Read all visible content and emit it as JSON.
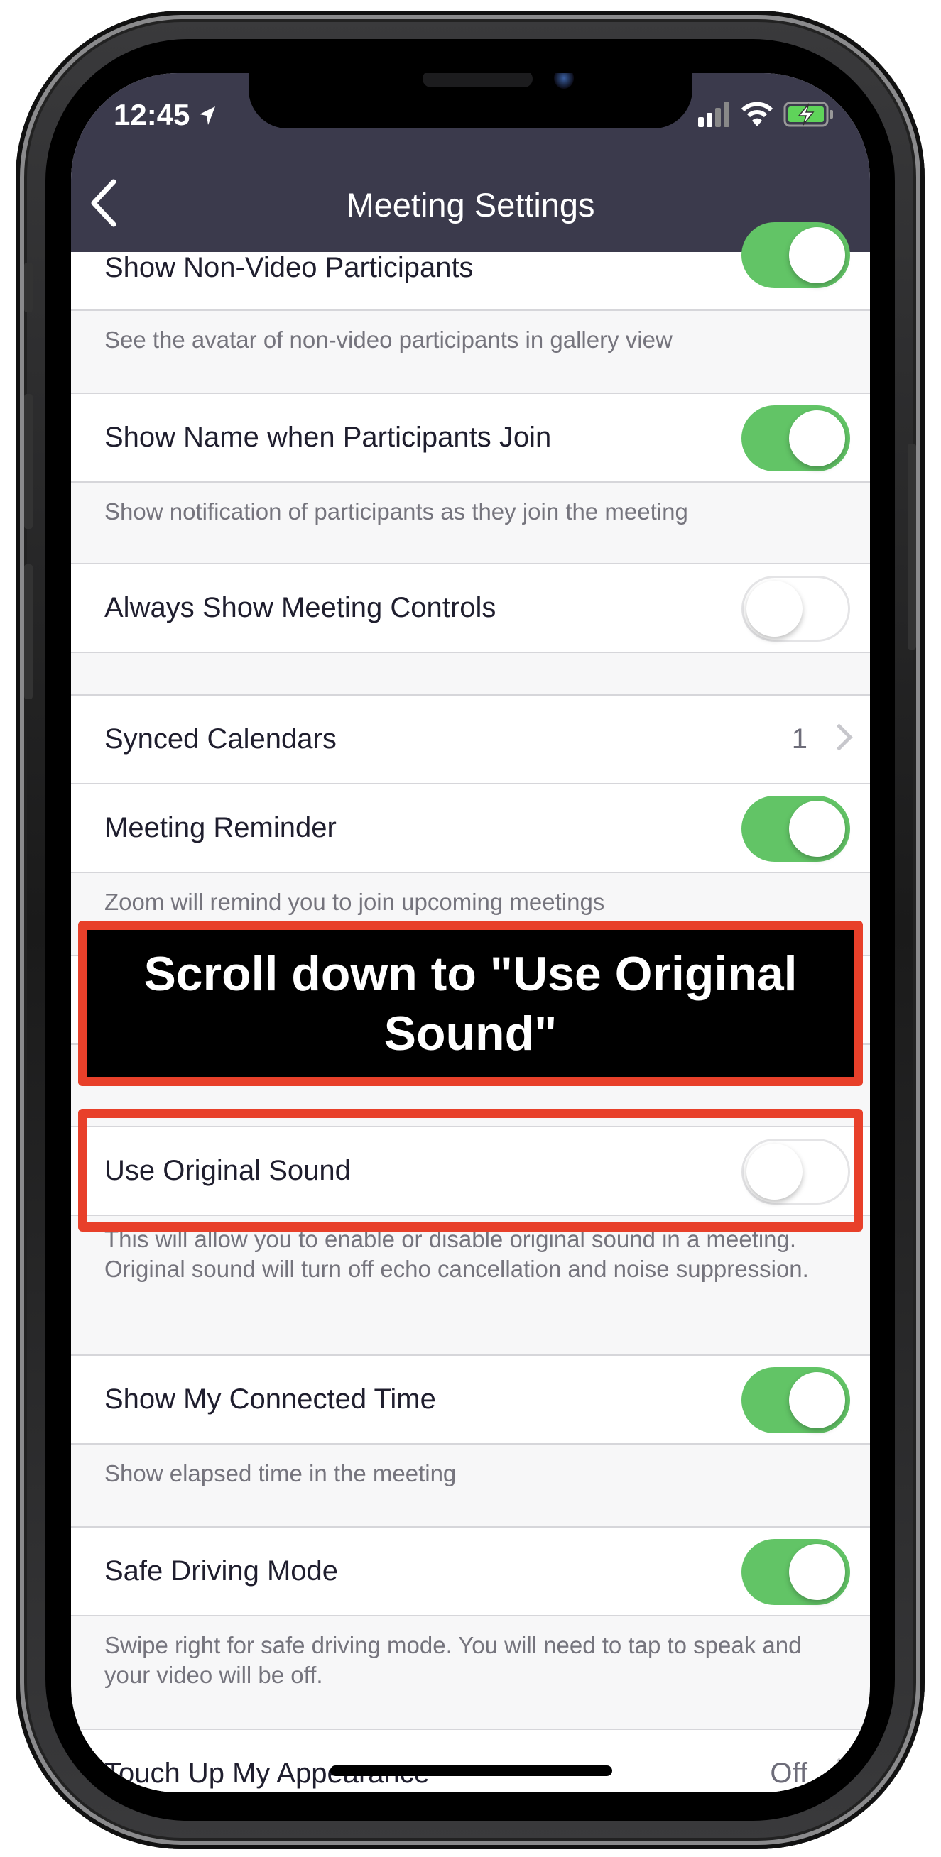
{
  "status_bar": {
    "time": "12:45",
    "icons": [
      "location-arrow-icon",
      "cellular-signal-icon",
      "wifi-icon",
      "battery-charging-icon"
    ]
  },
  "nav": {
    "title": "Meeting Settings",
    "back_icon": "chevron-left-icon"
  },
  "settings": [
    {
      "label": "Show Non-Video Participants",
      "toggle": true,
      "description": "See the avatar of non-video participants in gallery view"
    },
    {
      "label": "Show Name when Participants Join",
      "toggle": true,
      "description": "Show notification of participants as they join the meeting"
    },
    {
      "label": "Always Show Meeting Controls",
      "toggle": false
    },
    {
      "label": "Synced Calendars",
      "value": "1"
    },
    {
      "label": "Meeting Reminder",
      "toggle": true,
      "description": "Zoom will remind you to join upcoming meetings"
    },
    {
      "label": "Use Original Sound",
      "toggle": false,
      "description": "This will allow you to enable or disable original sound in a meeting. Original sound will turn off echo cancellation and noise suppression."
    },
    {
      "label": "Show My Connected Time",
      "toggle": true,
      "description": "Show elapsed time in the meeting"
    },
    {
      "label": "Safe Driving Mode",
      "toggle": true,
      "description": "Swipe right for safe driving mode. You will need to tap to speak and your video will be off."
    },
    {
      "label": "Touch Up My Appearance",
      "value": "Off"
    }
  ],
  "annotation": {
    "text": "Scroll down to \"Use Original Sound\"",
    "highlight_color": "#e8402a"
  },
  "colors": {
    "header": "#3b3a4c",
    "toggle_on": "#62c466"
  }
}
